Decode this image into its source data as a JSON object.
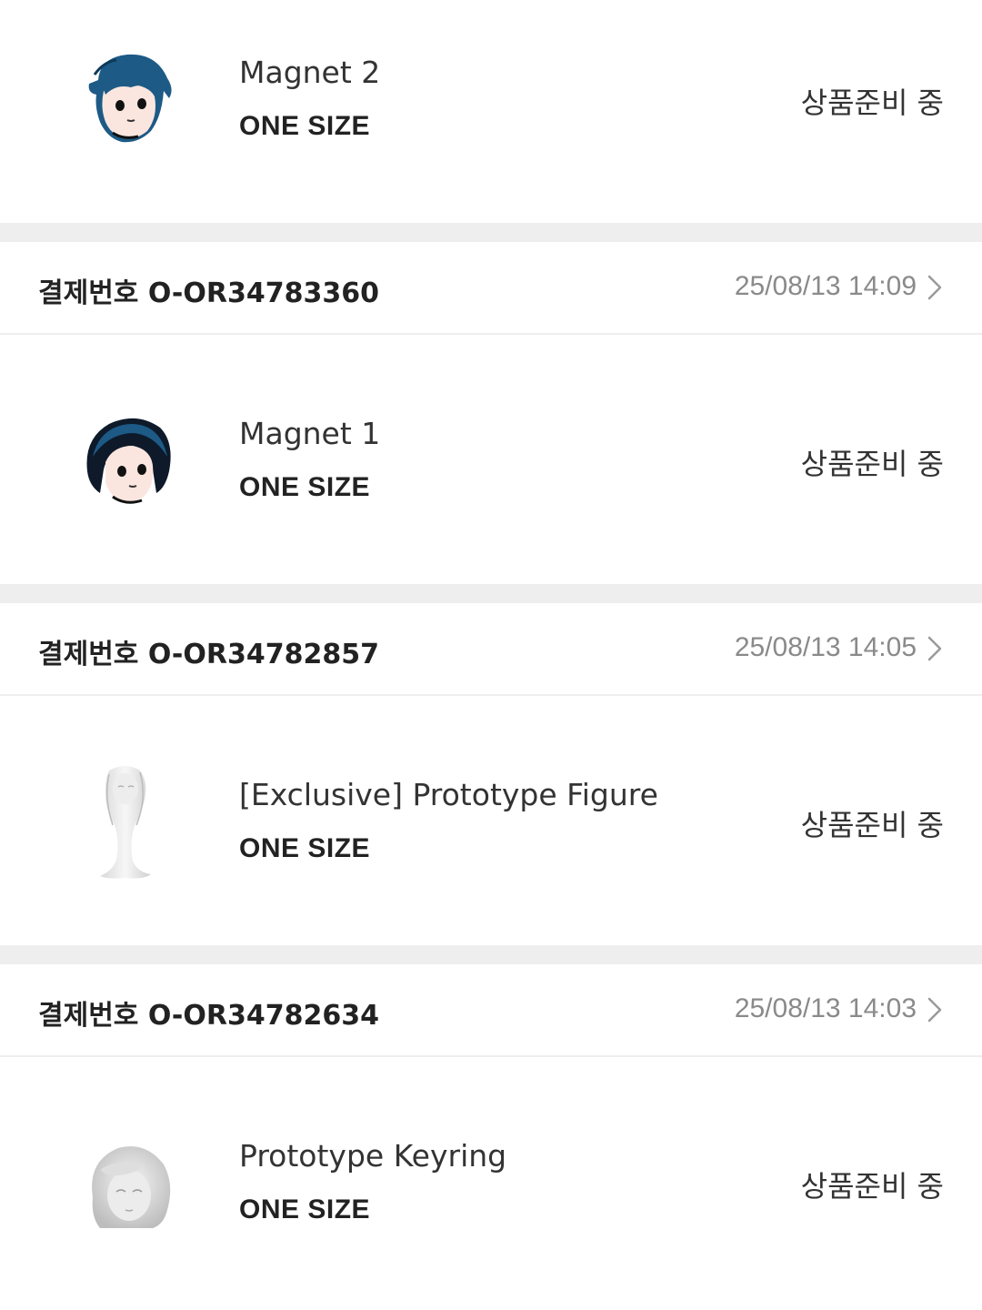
{
  "orders": [
    {
      "item": {
        "name": "Magnet 2",
        "size": "ONE SIZE",
        "status": "상품준비 중",
        "thumb": "blue-hair-character-magnet"
      }
    },
    {
      "order_label": "결제번호 O-OR34783360",
      "date": "25/08/13 14:09",
      "item": {
        "name": "Magnet 1",
        "size": "ONE SIZE",
        "status": "상품준비 중",
        "thumb": "dark-hair-character-magnet"
      }
    },
    {
      "order_label": "결제번호 O-OR34782857",
      "date": "25/08/13 14:05",
      "item": {
        "name": "[Exclusive] Prototype Figure",
        "size": "ONE SIZE",
        "status": "상품준비 중",
        "thumb": "white-figure"
      }
    },
    {
      "order_label": "결제번호 O-OR34782634",
      "date": "25/08/13 14:03",
      "item": {
        "name": "Prototype Keyring",
        "size": "ONE SIZE",
        "status": "상품준비 중",
        "thumb": "white-keyring-head"
      }
    }
  ],
  "colors": {
    "separator": "#eeeeee",
    "date_text": "#8a8a8a",
    "hair_blue": "#1d5a86"
  },
  "icons": {
    "chevron": "chevron-right-icon"
  }
}
